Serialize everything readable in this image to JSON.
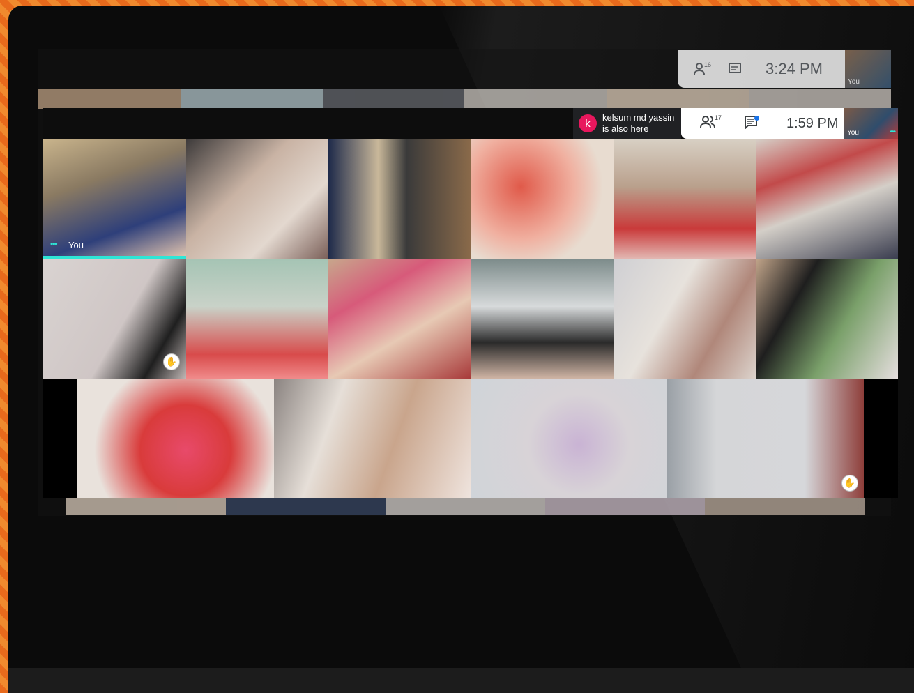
{
  "colors": {
    "accent": "#2ee6d6",
    "notif_avatar": "#e8175d",
    "chat_dot": "#1a73e8"
  },
  "background_meet": {
    "participants_count": "16",
    "time": "3:24 PM",
    "self_label": "You",
    "icons": [
      "people-icon",
      "chat-icon"
    ]
  },
  "notification": {
    "avatar_letter": "k",
    "line1": "kelsum md yassin",
    "line2": "is also here"
  },
  "controls": {
    "participants_count": "17",
    "time": "1:59 PM",
    "self_label": "You",
    "icons": [
      "people-icon",
      "chat-icon"
    ]
  },
  "tiles": [
    {
      "name": "You",
      "hand": false,
      "speaking": true
    },
    {
      "name": "",
      "hand": false
    },
    {
      "name": "",
      "hand": false
    },
    {
      "name": "",
      "hand": false
    },
    {
      "name": "",
      "hand": false
    },
    {
      "name": "",
      "hand": false
    },
    {
      "name": "",
      "hand": true
    },
    {
      "name": "",
      "hand": false
    },
    {
      "name": "",
      "hand": false
    },
    {
      "name": "",
      "hand": false
    },
    {
      "name": "",
      "hand": false
    },
    {
      "name": "",
      "hand": false
    },
    {
      "name": "",
      "hand": false
    },
    {
      "name": "",
      "hand": false
    },
    {
      "name": "",
      "hand": false
    },
    {
      "name": "",
      "hand": true
    }
  ]
}
